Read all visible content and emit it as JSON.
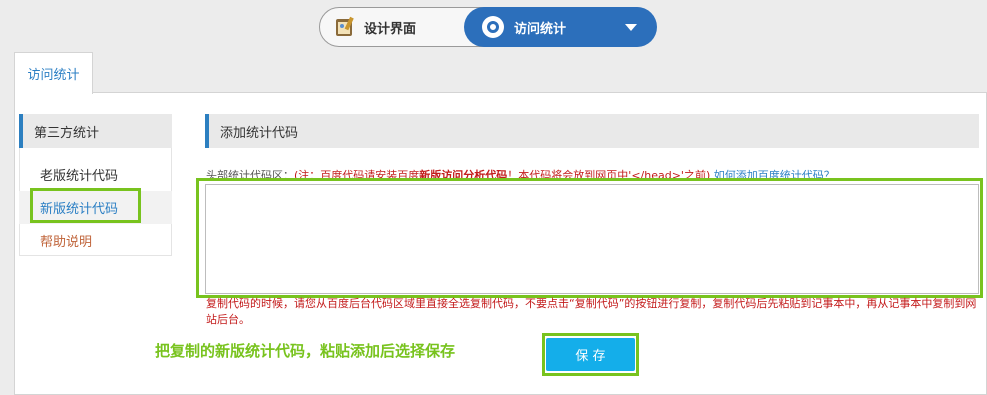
{
  "switcher": {
    "design_label": "设计界面",
    "stats_label": "访问统计",
    "design_icon": "brush-palette-icon",
    "stats_icon": "gear-icon",
    "accent_color": "#2c6fbb"
  },
  "tab": {
    "label": "访问统计"
  },
  "sidebar": {
    "header": "第三方统计",
    "items": [
      {
        "label": "老版统计代码",
        "state": "normal"
      },
      {
        "label": "新版统计代码",
        "state": "selected"
      },
      {
        "label": "帮助说明",
        "state": "normal"
      }
    ]
  },
  "main": {
    "section_title": "添加统计代码",
    "note": {
      "prefix": "头部统计代码区：",
      "warn_start": "(注：百度代码请安装百度",
      "warn_bold": "新版访问分析代码",
      "warn_end": "！本代码将会放到网页中'</head>'之前)",
      "link": "如何添加百度统计代码？"
    },
    "code_value": "",
    "hint": "复制代码的时候，请您从百度后台代码区域里直接全选复制代码，不要点击“复制代码”的按钮进行复制，复制代码后先粘贴到记事本中，再从记事本中复制到网站后台。",
    "save_label": "保 存"
  },
  "callout": {
    "text": "把复制的新版统计代码，粘贴添加后选择保存"
  },
  "colors": {
    "highlight": "#78c31e",
    "save_button": "#14aeea",
    "warning_text": "#c31b1b",
    "link": "#2b7fc4"
  }
}
